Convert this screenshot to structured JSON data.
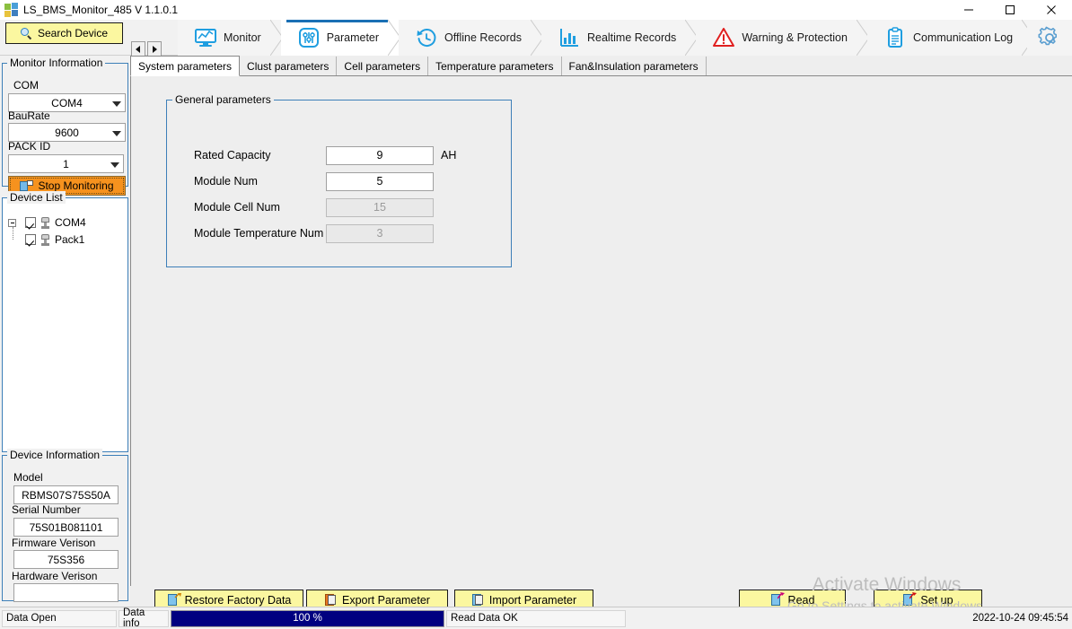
{
  "window": {
    "title": "LS_BMS_Monitor_485 V 1.1.0.1",
    "icon": "app-grid-icon",
    "minimize": "minimize-icon",
    "maximize": "maximize-icon",
    "close": "close-icon"
  },
  "ribbon": {
    "search_device_label": "Search Device",
    "prev_label": "◄",
    "next_label": "►",
    "tabs": [
      {
        "label": "Monitor",
        "icon": "monitor-chart-icon",
        "active": false
      },
      {
        "label": "Parameter",
        "icon": "sliders-icon",
        "active": true
      },
      {
        "label": "Offline Records",
        "icon": "clock-history-icon",
        "active": false
      },
      {
        "label": "Realtime Records",
        "icon": "bar-chart-icon",
        "active": false
      },
      {
        "label": "Warning & Protection",
        "icon": "warning-triangle-icon",
        "active": false
      },
      {
        "label": "Communication Log",
        "icon": "clipboard-icon",
        "active": false
      }
    ],
    "settings_icon": "gear-icon"
  },
  "sidebar": {
    "monitor_information": {
      "legend": "Monitor Information",
      "fields": [
        {
          "label": "COM",
          "value": "COM4"
        },
        {
          "label": "BauRate",
          "value": "9600"
        },
        {
          "label": "PACK ID",
          "value": "1"
        }
      ],
      "monitor_button": "Stop Monitoring"
    },
    "device_list": {
      "legend": "Device List",
      "root": {
        "label": "COM4",
        "checked": true,
        "expanded": true
      },
      "children": [
        {
          "label": "Pack1",
          "checked": true
        }
      ]
    },
    "device_information": {
      "legend": "Device Information",
      "fields": [
        {
          "label": "Model",
          "value": "RBMS07S75S50A"
        },
        {
          "label": "Serial Number",
          "value": "75S01B081101"
        },
        {
          "label": "Firmware Verison",
          "value": "75S356"
        },
        {
          "label": "Hardware Verison",
          "value": ""
        }
      ]
    }
  },
  "main": {
    "subtabs": [
      {
        "label": "System parameters",
        "active": true
      },
      {
        "label": "Clust parameters",
        "active": false
      },
      {
        "label": "Cell parameters",
        "active": false
      },
      {
        "label": "Temperature parameters",
        "active": false
      },
      {
        "label": "Fan&Insulation parameters",
        "active": false
      }
    ],
    "general_parameters": {
      "legend": "General parameters",
      "rows": [
        {
          "label": "Rated Capacity",
          "value": "9",
          "unit": "AH",
          "readonly": false
        },
        {
          "label": "Module Num",
          "value": "5",
          "unit": "",
          "readonly": false
        },
        {
          "label": "Module Cell Num",
          "value": "15",
          "unit": "",
          "readonly": true
        },
        {
          "label": "Module Temperature Num",
          "value": "3",
          "unit": "",
          "readonly": true
        }
      ]
    },
    "actions": {
      "restore": "Restore Factory Data",
      "export": "Export Parameter",
      "import": "Import Parameter",
      "read": "Read",
      "setup": "Set up"
    }
  },
  "watermark": {
    "line1": "Activate Windows",
    "line2": "Go to Settings to activate Windows."
  },
  "statusbar": {
    "data_open": "Data Open",
    "data_info": "Data info",
    "progress_text": "100 %",
    "progress_percent": 100,
    "message": "Read Data OK",
    "timestamp": "2022-10-24 09:45:54"
  },
  "colors": {
    "accent_blue": "#1a6fb4",
    "group_border": "#3d7fb8",
    "button_yellow": "#fbf7a0",
    "stop_orange": "#f6921e",
    "progress_navy": "#000080",
    "warning_red": "#e02020"
  }
}
